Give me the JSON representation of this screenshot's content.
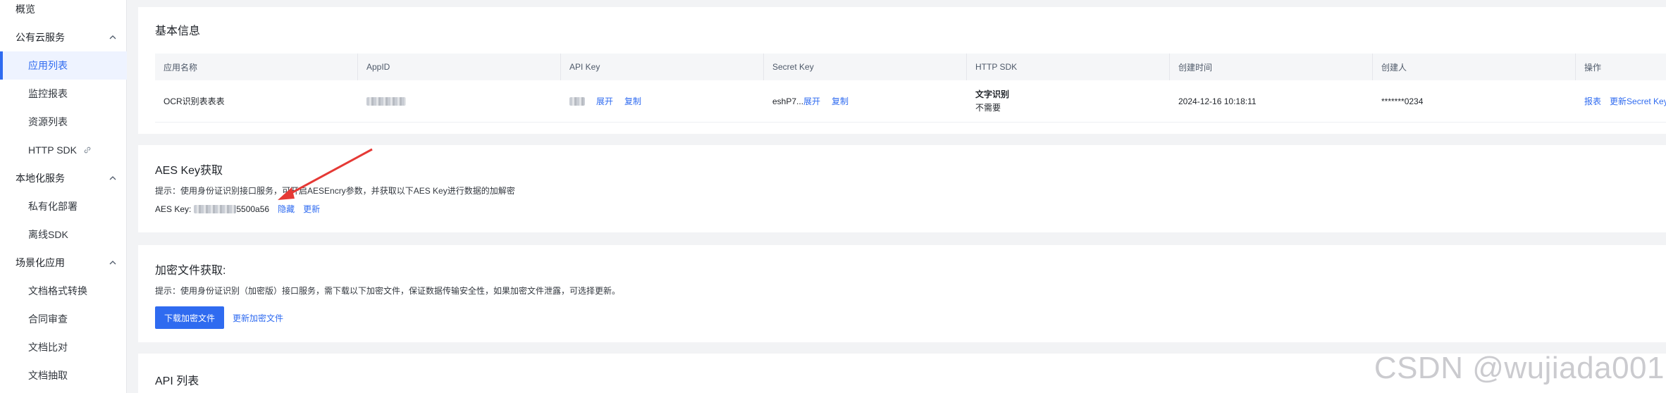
{
  "sidebar": {
    "overview": "概览",
    "groups": [
      {
        "label": "公有云服务",
        "items": [
          "应用列表",
          "监控报表",
          "资源列表",
          "HTTP SDK"
        ]
      },
      {
        "label": "本地化服务",
        "items": [
          "私有化部署",
          "离线SDK"
        ]
      },
      {
        "label": "场景化应用",
        "items": [
          "文档格式转换",
          "合同审查",
          "文档比对",
          "文档抽取"
        ]
      }
    ],
    "active_item": "应用列表",
    "external_link_item": "HTTP SDK"
  },
  "basic_info": {
    "title": "基本信息",
    "columns": [
      "应用名称",
      "AppID",
      "API Key",
      "Secret Key",
      "HTTP SDK",
      "创建时间",
      "创建人",
      "操作"
    ],
    "row": {
      "app_name": "OCR识别表表表",
      "api_key_expand": "展开",
      "api_key_copy": "复制",
      "secret_key_prefix": "eshP7...",
      "secret_key_expand": "展开",
      "secret_key_copy": "复制",
      "sdk_name": "文字识别",
      "sdk_status": "不需要",
      "created_at": "2024-12-16 10:18:11",
      "creator": "*******0234",
      "action_report": "报表",
      "action_update": "更新Secret Key"
    }
  },
  "aes": {
    "title": "AES Key获取",
    "hint": "提示：使用身份证识别接口服务，可开启AESEncry参数，并获取以下AES Key进行数据的加解密",
    "key_label": "AES Key:",
    "key_suffix": "5500a56",
    "hide": "隐藏",
    "update": "更新"
  },
  "encrypt_file": {
    "title": "加密文件获取:",
    "hint": "提示：使用身份证识别（加密版）接口服务，需下载以下加密文件，保证数据传输安全性，如果加密文件泄露，可选择更新。",
    "download": "下载加密文件",
    "update": "更新加密文件"
  },
  "api_list": {
    "title": "API 列表"
  },
  "watermark": "CSDN @wujiada001",
  "colors": {
    "accent": "#2f6bf0",
    "annotation_arrow": "#e53935"
  }
}
